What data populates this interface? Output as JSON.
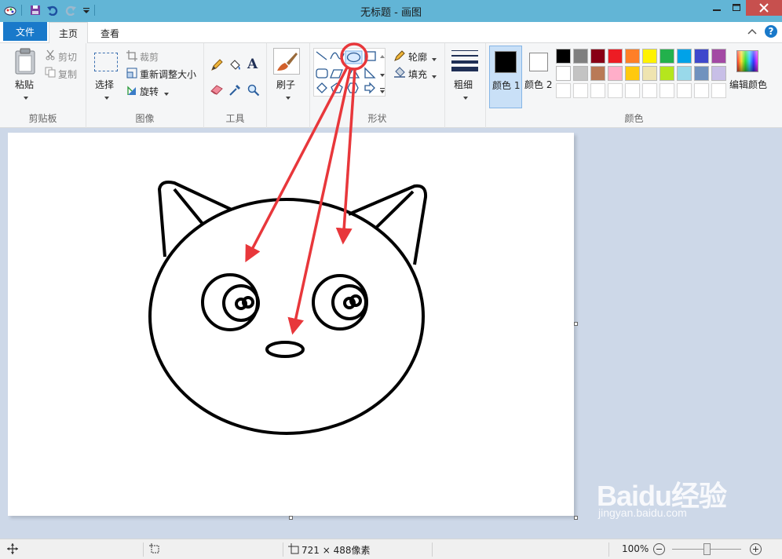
{
  "window": {
    "title": "无标题 - 画图"
  },
  "tabs": {
    "file": "文件",
    "home": "主页",
    "view": "查看"
  },
  "clipboard": {
    "paste": "粘贴",
    "cut": "剪切",
    "copy": "复制",
    "group": "剪贴板"
  },
  "image": {
    "select": "选择",
    "crop": "裁剪",
    "resize": "重新调整大小",
    "rotate": "旋转",
    "group": "图像"
  },
  "tools": {
    "group": "工具"
  },
  "brushes": {
    "label": "刷子"
  },
  "shapes": {
    "outline": "轮廓",
    "fill": "填充",
    "group": "形状"
  },
  "size": {
    "label": "粗细"
  },
  "colors": {
    "color1": "颜色 1",
    "color2": "颜色 2",
    "edit": "编辑颜色",
    "group": "颜色",
    "row1": [
      "#000000",
      "#7f7f7f",
      "#880015",
      "#ed1c24",
      "#ff7f27",
      "#fff200",
      "#22b14c",
      "#00a2e8",
      "#3f48cc",
      "#a349a4"
    ],
    "row2": [
      "#ffffff",
      "#c3c3c3",
      "#b97a57",
      "#ffaec9",
      "#ffc90e",
      "#efe4b0",
      "#b5e61d",
      "#99d9ea",
      "#7092be",
      "#c8bfe7"
    ]
  },
  "status": {
    "canvas_size": "721 × 488像素",
    "zoom": "100%"
  },
  "watermark": {
    "brand": "Baidu经验",
    "url": "jingyan.baidu.com"
  },
  "accent": "#1979ca",
  "annotation_color": "#e8373b"
}
